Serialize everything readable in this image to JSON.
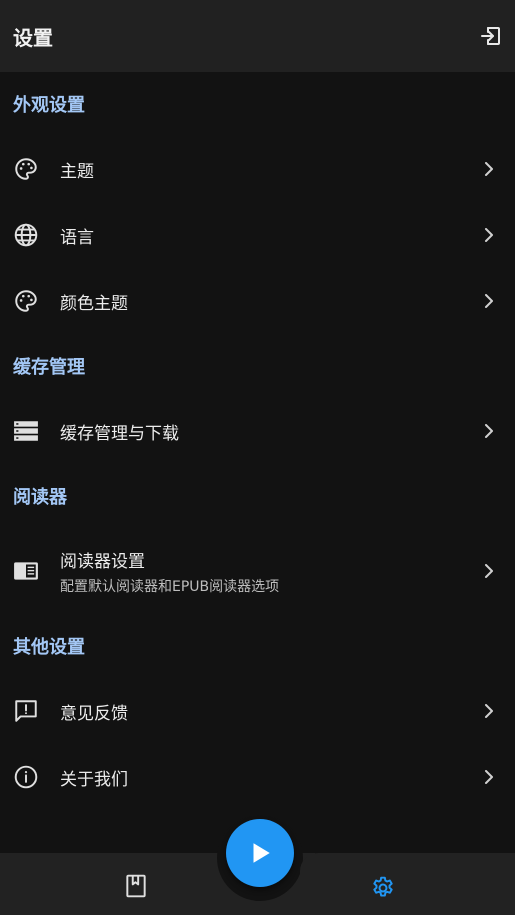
{
  "topbar": {
    "title": "设置",
    "exit_icon": "logout-icon"
  },
  "sections": {
    "appearance": {
      "title": "外观设置",
      "items": [
        {
          "label": "主题",
          "icon": "palette-icon"
        },
        {
          "label": "语言",
          "icon": "globe-icon"
        },
        {
          "label": "颜色主题",
          "icon": "palette-icon"
        }
      ]
    },
    "cache": {
      "title": "缓存管理",
      "items": [
        {
          "label": "缓存管理与下载",
          "icon": "storage-icon"
        }
      ]
    },
    "reader": {
      "title": "阅读器",
      "items": [
        {
          "label": "阅读器设置",
          "subtitle": "配置默认阅读器和EPUB阅读器选项",
          "icon": "reader-icon"
        }
      ]
    },
    "other": {
      "title": "其他设置",
      "items": [
        {
          "label": "意见反馈",
          "icon": "feedback-icon"
        },
        {
          "label": "关于我们",
          "icon": "info-icon"
        }
      ]
    }
  },
  "bottom_nav": {
    "items": [
      {
        "icon": "book-icon",
        "active": false
      },
      {
        "icon": "gear-icon",
        "active": true
      }
    ],
    "fab_icon": "play-icon"
  },
  "colors": {
    "background": "#121212",
    "topbar": "#212121",
    "section_header": "#a3c7f5",
    "accent": "#2196f3"
  }
}
